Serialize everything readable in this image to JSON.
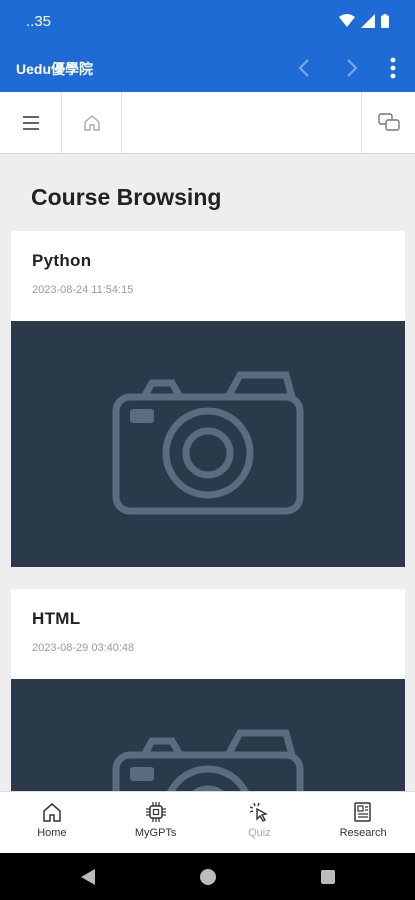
{
  "status_bar": {
    "time": "..35"
  },
  "app_bar": {
    "title": "Uedu優學院",
    "icons": [
      "chevron-left-icon",
      "chevron-right-icon",
      "more-vert-icon"
    ]
  },
  "toolbar": {
    "icons": [
      "menu-icon",
      "home-icon",
      "chat-icon"
    ]
  },
  "page_title": "Course Browsing",
  "courses": [
    {
      "title": "Python",
      "date": "2023-08-24 11:54:15",
      "image": "camera-placeholder"
    },
    {
      "title": "HTML",
      "date": "2023-08-29 03:40:48",
      "image": "camera-placeholder"
    }
  ],
  "bottom_nav": {
    "items": [
      {
        "label": "Home",
        "icon": "home-icon"
      },
      {
        "label": "MyGPTs",
        "icon": "chip-icon"
      },
      {
        "label": "Quiz",
        "icon": "click-icon"
      },
      {
        "label": "Research",
        "icon": "document-icon"
      }
    ]
  },
  "colors": {
    "primary": "#1e6bd6",
    "image_bg": "#2b3a4b",
    "placeholder_icon": "#5a6d80"
  }
}
